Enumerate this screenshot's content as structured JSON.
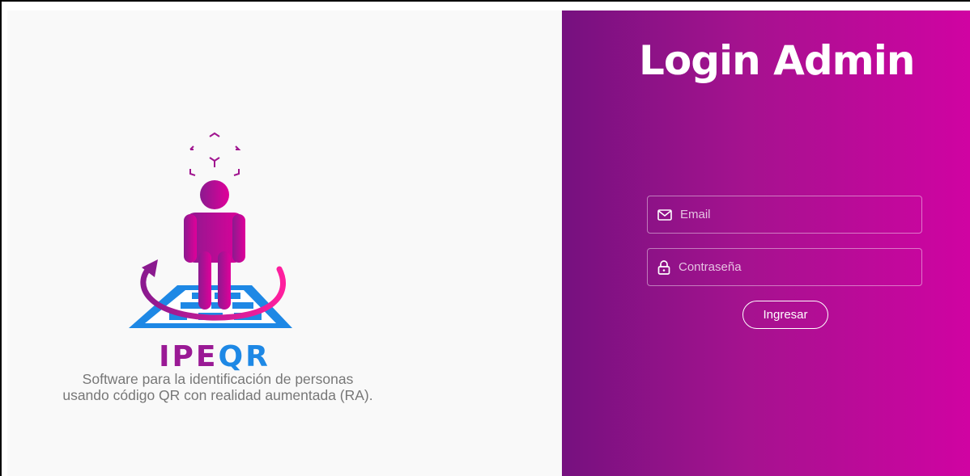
{
  "brand": {
    "name": "IPEQR",
    "name_parts": [
      "IPE",
      "QR"
    ],
    "tagline_lines": [
      "Software para la identificación de personas",
      "usando código QR con realidad aumentada (RA)."
    ],
    "colors": {
      "magenta": "#e0009a",
      "purple": "#8b1a8f",
      "blue": "#1e88e5"
    }
  },
  "login": {
    "title": "Login Admin",
    "email": {
      "placeholder": "Email",
      "value": "",
      "icon": "mail-icon"
    },
    "password": {
      "placeholder": "Contraseña",
      "value": "",
      "icon": "lock-icon"
    },
    "submit_label": "Ingresar"
  },
  "theme": {
    "gradient_start": "#76117f",
    "gradient_end": "#d003a2",
    "left_background": "#f9f9f9"
  }
}
